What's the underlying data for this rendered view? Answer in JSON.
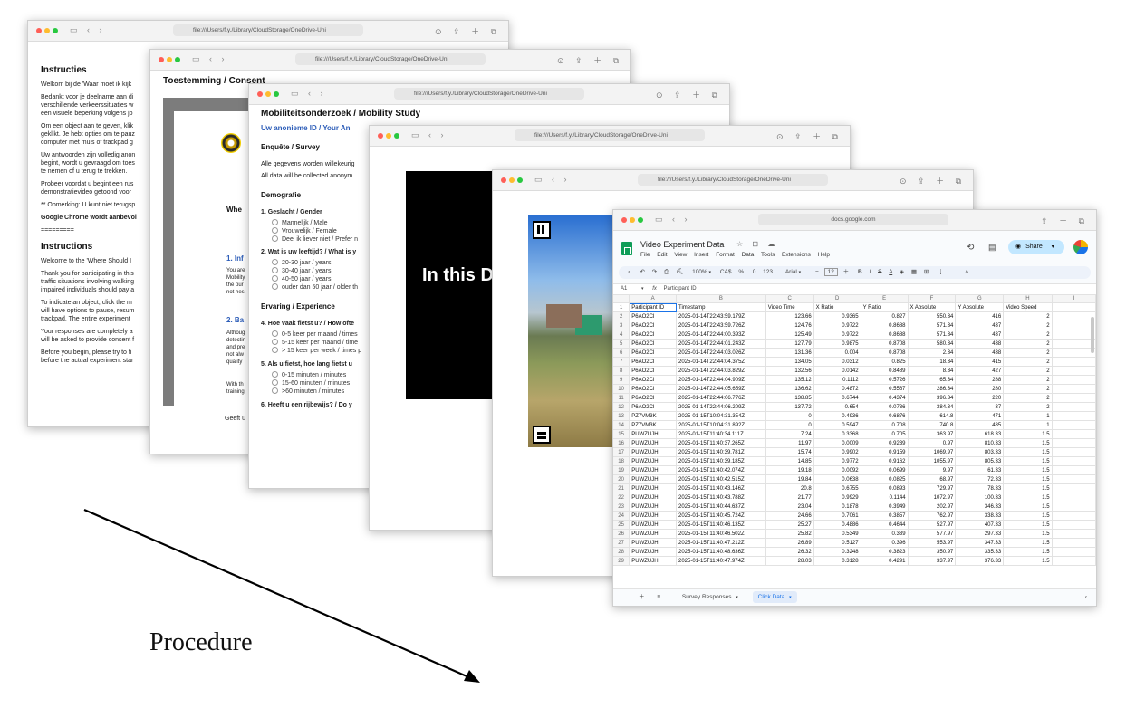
{
  "url_local": "file:///Users/f.y./Library/CloudStorage/OneDrive-Uni",
  "url_docs": "docs.google.com",
  "window1": {
    "title": "Instructies",
    "p1": "Welkom bij de 'Waar moet ik kijk",
    "p2": [
      "Bedankt voor je deelname aan di",
      "verschillende verkeerssituaties w",
      "een visuele beperking volgens jo"
    ],
    "p3": [
      "Om een object aan te geven, klik",
      "geklikt. Je hebt opties om te pauz",
      "computer met muis of trackpad g"
    ],
    "p4": [
      "Uw antwoorden zijn volledig anon",
      "begint, wordt u gevraagd om toes",
      "te nemen of u terug te trekken."
    ],
    "p5": [
      "Probeer voordat u begint een rus",
      "demonstratievideo getoond voor"
    ],
    "p6": "** Opmerking: U kunt niet terugsp",
    "p7": "Google Chrome wordt aanbevol",
    "sep": "=========",
    "title2": "Instructions",
    "q1": "Welcome to the 'Where Should I",
    "q2": [
      "Thank you for participating in this",
      "traffic situations involving walking",
      "impaired individuals should pay a"
    ],
    "q3": [
      "To indicate an object, click the m",
      "will have options to pause, resum",
      "trackpad. The entire experiment"
    ],
    "q4": [
      "Your responses are completely a",
      "will be asked to provide consent f"
    ],
    "q5": [
      "Before you begin, please try to fi",
      "before the actual experiment star"
    ]
  },
  "window2": {
    "title": "Toestemming / Consent",
    "heading": "Whe",
    "s1": "1. Inf",
    "s1_lines": [
      "You are",
      "Mobility",
      "the pur",
      "not hes"
    ],
    "s2": "2. Ba",
    "s2_lines": [
      "Althoug",
      "detectin",
      "and pre",
      "not alw",
      "quality"
    ],
    "s3_lines": [
      "With th",
      "training"
    ],
    "footer": "Geeft u"
  },
  "window3": {
    "title": "Mobiliteitsonderzoek / Mobility Study",
    "id_label": "Uw anonieme ID / Your An",
    "survey": "Enquête / Survey",
    "note1": "Alle gegevens worden willekeurig",
    "note2": "All data will be collected anonym",
    "demo": "Demografie",
    "q1": "1. Geslacht / Gender",
    "q1_opts": [
      "Mannelijk / Male",
      "Vrouwelijk / Female",
      "Deel ik liever niet / Prefer n"
    ],
    "q2": "2. Wat is uw leeftijd? / What is y",
    "q2_opts": [
      "20-30 jaar / years",
      "30-40 jaar / years",
      "40-50 jaar / years",
      "ouder dan 50 jaar / older th"
    ],
    "exp": "Ervaring / Experience",
    "q4": "4. Hoe vaak fietst u? / How ofte",
    "q4_opts": [
      "0-5 keer per maand / times",
      "5-15 keer per maand / time",
      "> 15 keer per week / times p"
    ],
    "q5": "5. Als u fietst, hoe lang fietst u",
    "q5_opts": [
      "0-15 minuten / minutes",
      "15-60 minuten / minutes",
      ">60 minuten / minutes"
    ],
    "q6": "6. Heeft u een rijbewijs? / Do y"
  },
  "window4": {
    "video_text": "In this D"
  },
  "window6": {
    "doc_title": "Video Experiment Data",
    "menu": [
      "File",
      "Edit",
      "View",
      "Insert",
      "Format",
      "Data",
      "Tools",
      "Extensions",
      "Help"
    ],
    "share": "Share",
    "zoom": "100%",
    "font": "Arial",
    "font_size": "12",
    "cell_ref": "A1",
    "formula": "Participant ID",
    "col_letters": [
      "",
      "A",
      "B",
      "C",
      "D",
      "E",
      "F",
      "G",
      "H",
      "I"
    ],
    "headers": [
      "Participant ID",
      "Timestamp",
      "Video Time",
      "X Ratio",
      "Y Ratio",
      "X Absolute",
      "Y Absolute",
      "Video Speed"
    ],
    "rows": [
      [
        "P6AO2CI",
        "2025-01-14T22:43:59.179Z",
        "123.66",
        "0.9365",
        "0.827",
        "550.34",
        "416",
        "2"
      ],
      [
        "P6AO2CI",
        "2025-01-14T22:43:59.726Z",
        "124.76",
        "0.9722",
        "0.8688",
        "571.34",
        "437",
        "2"
      ],
      [
        "P6AO2CI",
        "2025-01-14T22:44:00.393Z",
        "125.49",
        "0.9722",
        "0.8688",
        "571.34",
        "437",
        "2"
      ],
      [
        "P6AO2CI",
        "2025-01-14T22:44:01.243Z",
        "127.79",
        "0.9875",
        "0.8708",
        "580.34",
        "438",
        "2"
      ],
      [
        "P6AO2CI",
        "2025-01-14T22:44:03.026Z",
        "131.36",
        "0.004",
        "0.8708",
        "2.34",
        "438",
        "2"
      ],
      [
        "P6AO2CI",
        "2025-01-14T22:44:04.375Z",
        "134.05",
        "0.0312",
        "0.825",
        "18.34",
        "415",
        "2"
      ],
      [
        "P6AO2CI",
        "2025-01-14T22:44:03.829Z",
        "132.56",
        "0.0142",
        "0.8489",
        "8.34",
        "427",
        "2"
      ],
      [
        "P6AO2CI",
        "2025-01-14T22:44:04.909Z",
        "135.12",
        "0.1112",
        "0.5726",
        "65.34",
        "288",
        "2"
      ],
      [
        "P6AO2CI",
        "2025-01-14T22:44:05.659Z",
        "136.62",
        "0.4872",
        "0.5567",
        "286.34",
        "280",
        "2"
      ],
      [
        "P6AO2CI",
        "2025-01-14T22:44:06.776Z",
        "138.85",
        "0.6744",
        "0.4374",
        "396.34",
        "220",
        "2"
      ],
      [
        "P6AO2CI",
        "2025-01-14T22:44:06.209Z",
        "137.72",
        "0.654",
        "0.0736",
        "384.34",
        "37",
        "2"
      ],
      [
        "PZ7VM3K",
        "2025-01-15T10:04:31.354Z",
        "0",
        "0.4936",
        "0.6876",
        "614.8",
        "471",
        "1"
      ],
      [
        "PZ7VM3K",
        "2025-01-15T10:04:31.892Z",
        "0",
        "0.5947",
        "0.708",
        "740.8",
        "485",
        "1"
      ],
      [
        "PUWZUJH",
        "2025-01-15T11:40:34.111Z",
        "7.24",
        "0.3368",
        "0.705",
        "363.97",
        "618.33",
        "1.5"
      ],
      [
        "PUWZUJH",
        "2025-01-15T11:40:37.265Z",
        "11.97",
        "0.0009",
        "0.9239",
        "0.97",
        "810.33",
        "1.5"
      ],
      [
        "PUWZUJH",
        "2025-01-15T11:40:39.781Z",
        "15.74",
        "0.9902",
        "0.9159",
        "1069.97",
        "803.33",
        "1.5"
      ],
      [
        "PUWZUJH",
        "2025-01-15T11:40:39.185Z",
        "14.85",
        "0.9772",
        "0.9162",
        "1055.97",
        "805.33",
        "1.5"
      ],
      [
        "PUWZUJH",
        "2025-01-15T11:40:42.074Z",
        "19.18",
        "0.0092",
        "0.0699",
        "9.97",
        "61.33",
        "1.5"
      ],
      [
        "PUWZUJH",
        "2025-01-15T11:40:42.515Z",
        "19.84",
        "0.0638",
        "0.0825",
        "68.97",
        "72.33",
        "1.5"
      ],
      [
        "PUWZUJH",
        "2025-01-15T11:40:43.146Z",
        "20.8",
        "0.6755",
        "0.0893",
        "729.97",
        "78.33",
        "1.5"
      ],
      [
        "PUWZUJH",
        "2025-01-15T11:40:43.788Z",
        "21.77",
        "0.9929",
        "0.1144",
        "1072.97",
        "100.33",
        "1.5"
      ],
      [
        "PUWZUJH",
        "2025-01-15T11:40:44.637Z",
        "23.04",
        "0.1878",
        "0.3949",
        "202.97",
        "346.33",
        "1.5"
      ],
      [
        "PUWZUJH",
        "2025-01-15T11:40:45.724Z",
        "24.66",
        "0.7061",
        "0.3857",
        "762.97",
        "338.33",
        "1.5"
      ],
      [
        "PUWZUJH",
        "2025-01-15T11:40:46.135Z",
        "25.27",
        "0.4886",
        "0.4644",
        "527.97",
        "407.33",
        "1.5"
      ],
      [
        "PUWZUJH",
        "2025-01-15T11:40:46.502Z",
        "25.82",
        "0.5349",
        "0.339",
        "577.97",
        "297.33",
        "1.5"
      ],
      [
        "PUWZUJH",
        "2025-01-15T11:40:47.212Z",
        "26.89",
        "0.5127",
        "0.396",
        "553.97",
        "347.33",
        "1.5"
      ],
      [
        "PUWZUJH",
        "2025-01-15T11:40:48.636Z",
        "26.32",
        "0.3248",
        "0.3823",
        "350.97",
        "335.33",
        "1.5"
      ],
      [
        "PUWZUJH",
        "2025-01-15T11:40:47.974Z",
        "28.03",
        "0.3128",
        "0.4291",
        "337.97",
        "376.33",
        "1.5"
      ]
    ],
    "tabs": [
      "Survey Responses",
      "Click Data"
    ]
  },
  "procedure_label": "Procedure",
  "colors": {
    "accent_blue": "#1a73e8",
    "sheets_green": "#0f9d58",
    "share_bg": "#c2e7ff"
  }
}
